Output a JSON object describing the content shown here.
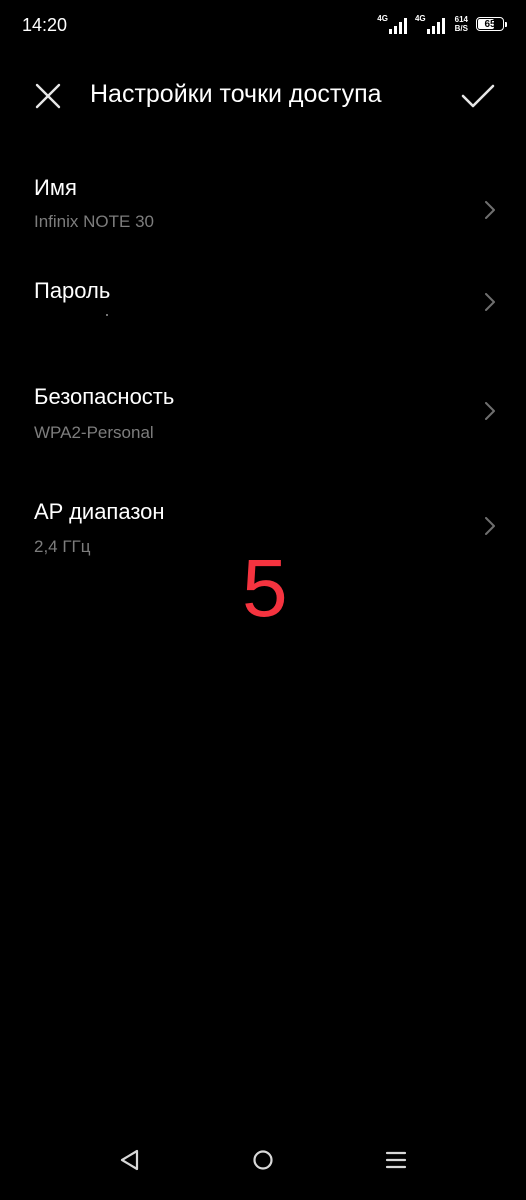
{
  "status_bar": {
    "time": "14:20",
    "network_1": "4G",
    "network_2": "4G",
    "speed_value": "614",
    "speed_unit": "B/S",
    "battery": "65",
    "battery_level": 0.65
  },
  "header": {
    "title": "Настройки точки доступа",
    "close_icon": "close-icon",
    "confirm_icon": "checkmark-icon"
  },
  "settings": [
    {
      "label": "Имя",
      "value": "Infinix NOTE 30"
    },
    {
      "label": "Пароль",
      "value": ""
    },
    {
      "label": "Безопасность",
      "value": "WPA2-Personal"
    },
    {
      "label": "AP диапазон",
      "value": "2,4 ГГц"
    }
  ],
  "overlay": {
    "number": "5",
    "color": "#f5333f"
  },
  "navigation": {
    "back_icon": "back-triangle-icon",
    "home_icon": "home-circle-icon",
    "recents_icon": "menu-lines-icon"
  }
}
